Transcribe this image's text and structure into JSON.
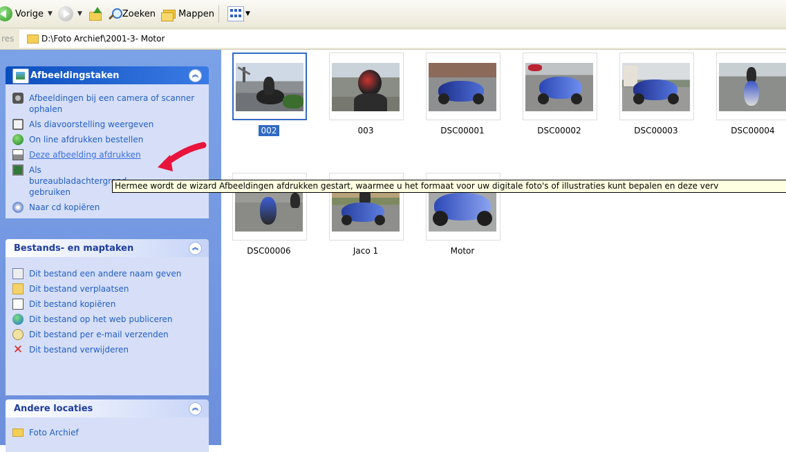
{
  "toolbar": {
    "back_label": "Vorige",
    "search_label": "Zoeken",
    "folders_label": "Mappen"
  },
  "address": {
    "label": "res",
    "path": "D:\\Foto Archief\\2001-3- Motor"
  },
  "panels": {
    "picture_tasks": {
      "title": "Afbeeldingstaken",
      "items": [
        {
          "label": "Afbeeldingen bij een camera of scanner ophalen",
          "icon": "camera-icon"
        },
        {
          "label": "Als diavoorstelling weergeven",
          "icon": "slideshow-icon"
        },
        {
          "label": "On line afdrukken bestellen",
          "icon": "globe-icon"
        },
        {
          "label": "Deze afbeelding afdrukken",
          "icon": "printer-icon"
        },
        {
          "label": "Als bureaubladachtergrond gebruiken",
          "icon": "desktop-icon"
        },
        {
          "label": "Naar cd kopiëren",
          "icon": "cd-icon"
        }
      ]
    },
    "file_tasks": {
      "title": "Bestands- en maptaken",
      "items": [
        {
          "label": "Dit bestand een andere naam geven",
          "icon": "rename-icon"
        },
        {
          "label": "Dit bestand verplaatsen",
          "icon": "move-icon"
        },
        {
          "label": "Dit bestand kopiëren",
          "icon": "copy-icon"
        },
        {
          "label": "Dit bestand op het web publiceren",
          "icon": "web-publish-icon"
        },
        {
          "label": "Dit bestand per e-mail verzenden",
          "icon": "email-icon"
        },
        {
          "label": "Dit bestand verwijderen",
          "icon": "delete-icon"
        }
      ]
    },
    "other_places": {
      "title": "Andere locaties",
      "items": [
        {
          "label": "Foto Archief",
          "icon": "folder-icon"
        }
      ]
    }
  },
  "files": [
    {
      "name": "002",
      "selected": true
    },
    {
      "name": "003"
    },
    {
      "name": "DSC00001"
    },
    {
      "name": "DSC00002"
    },
    {
      "name": "DSC00003"
    },
    {
      "name": "DSC00004"
    },
    {
      "name": "DSC00006"
    },
    {
      "name": "Jaco 1"
    },
    {
      "name": "Motor"
    }
  ],
  "tooltip": "Hermee wordt de wizard Afbeeldingen afdrukken gestart, waarmee u het formaat voor uw digitale foto's of illustraties kunt bepalen en deze verv",
  "colors": {
    "task_pane_blue": "#6d8fdc",
    "header_dark": "#0a4ebe",
    "link_blue": "#215dc6",
    "selection": "#316ac5",
    "tooltip_bg": "#ffffe1",
    "arrow_red": "#e8143c"
  }
}
